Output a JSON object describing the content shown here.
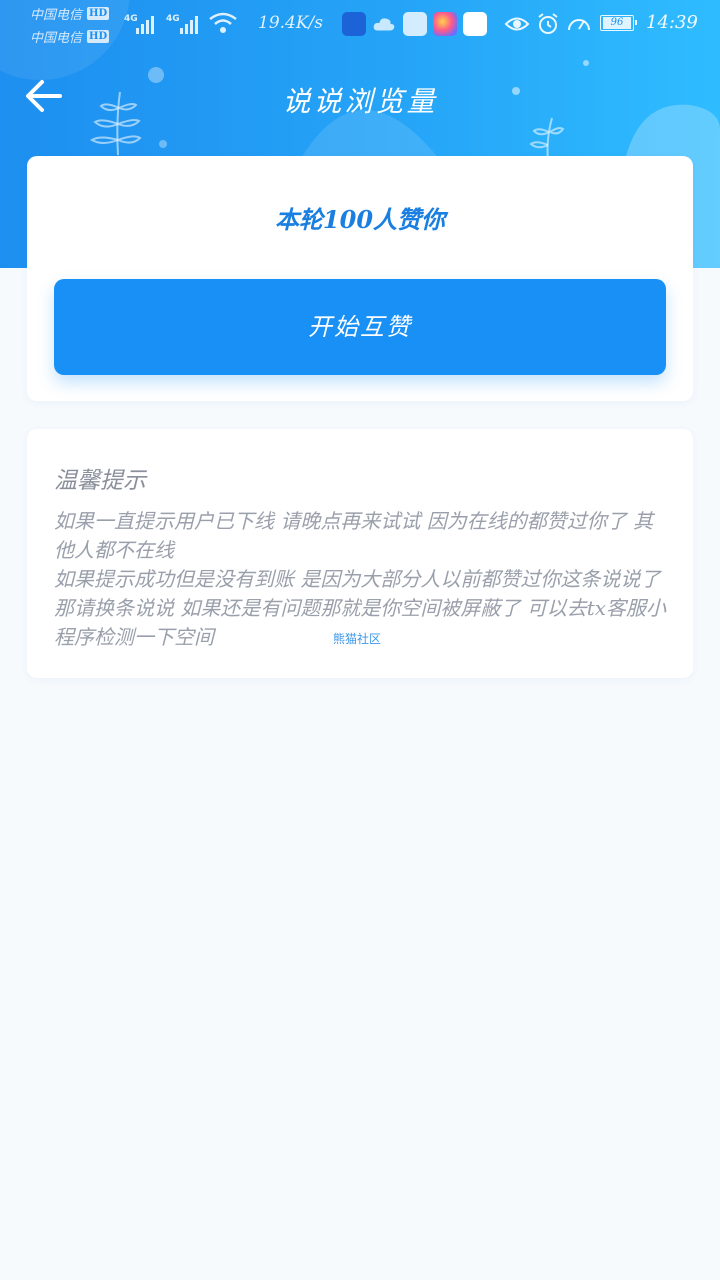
{
  "status_bar": {
    "carrier_1": "中国电信",
    "carrier_2": "中国电信",
    "hd_badge": "HD",
    "network_type": "4G",
    "net_speed": "19.4K/s",
    "battery_level": "96",
    "time": "14:39",
    "icons": [
      "signal-icon",
      "wifi-icon",
      "app-icon",
      "cloud-icon",
      "delivery-icon",
      "colorful-app-icon",
      "square-app-icon",
      "eye-icon",
      "alarm-icon",
      "speed-icon",
      "battery-icon"
    ]
  },
  "header": {
    "title": "说说浏览量",
    "back_icon": "arrow-left-icon"
  },
  "main_card": {
    "round_text": "本轮100人赞你",
    "start_button": "开始互赞"
  },
  "tips": {
    "title": "温馨提示",
    "lines": [
      "如果一直提示用户已下线 请晚点再来试试 因为在线的都赞过你了 其他人都不在线",
      "如果提示成功但是没有到账 是因为大部分人以前都赞过你这条说说了 那请换条说说 如果还是有问题那就是你空间被屏蔽了 可以去tx客服小程序检测一下空间"
    ],
    "watermark": "熊猫社区"
  },
  "colors": {
    "header_gradient_start": "#1d8ff0",
    "header_gradient_end": "#2fbcff",
    "primary_button": "#1890f5",
    "round_text": "#1a7fe0",
    "page_background": "#f6fafd"
  }
}
